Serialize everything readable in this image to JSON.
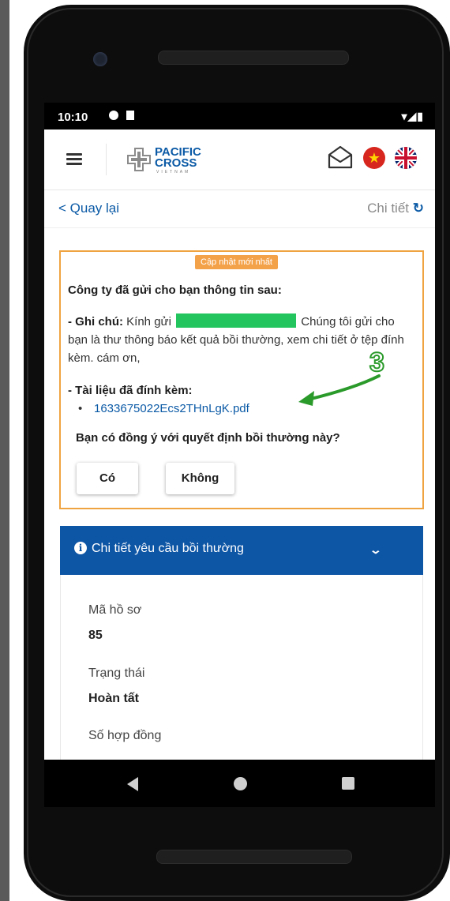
{
  "status_bar": {
    "time": "10:10",
    "right_icons": "▾◢▮"
  },
  "header": {
    "logo_line1": "PACIFIC",
    "logo_line2": "CROSS",
    "logo_sub": "VIETNAM"
  },
  "nav": {
    "back_label": "< Quay lại",
    "detail_label": "Chi tiết",
    "refresh_glyph": "↻"
  },
  "notice": {
    "badge": "Cập nhật mới nhất",
    "heading": "Công ty đã gửi cho bạn thông tin sau:",
    "note_label": "- Ghi chú:",
    "note_prefix": "Kính gửi",
    "note_suffix": "Chúng tôi gửi cho bạn là thư thông báo kết quả bồi thường, xem chi tiết ở tệp đính kèm. cám ơn,",
    "attach_heading": "- Tài liệu đã đính kèm:",
    "attachment": "1633675022Ecs2THnLgK.pdf",
    "question": "Bạn có đồng ý với quyết định bồi thường này?",
    "yes_label": "Có",
    "no_label": "Không"
  },
  "annotation": {
    "number": "3",
    "color": "#2a9a2a"
  },
  "claim": {
    "title": "Chi tiết yêu cầu bồi thường",
    "fields": [
      {
        "label": "Mã hồ sơ",
        "value": "85"
      },
      {
        "label": "Trạng thái",
        "value": "Hoàn tất"
      },
      {
        "label": "Số hợp đồng",
        "value": ""
      }
    ]
  },
  "colors": {
    "primary": "#0d55a5",
    "accent": "#f0a441",
    "link": "#0b5aa6",
    "redaction": "#22c55e"
  }
}
